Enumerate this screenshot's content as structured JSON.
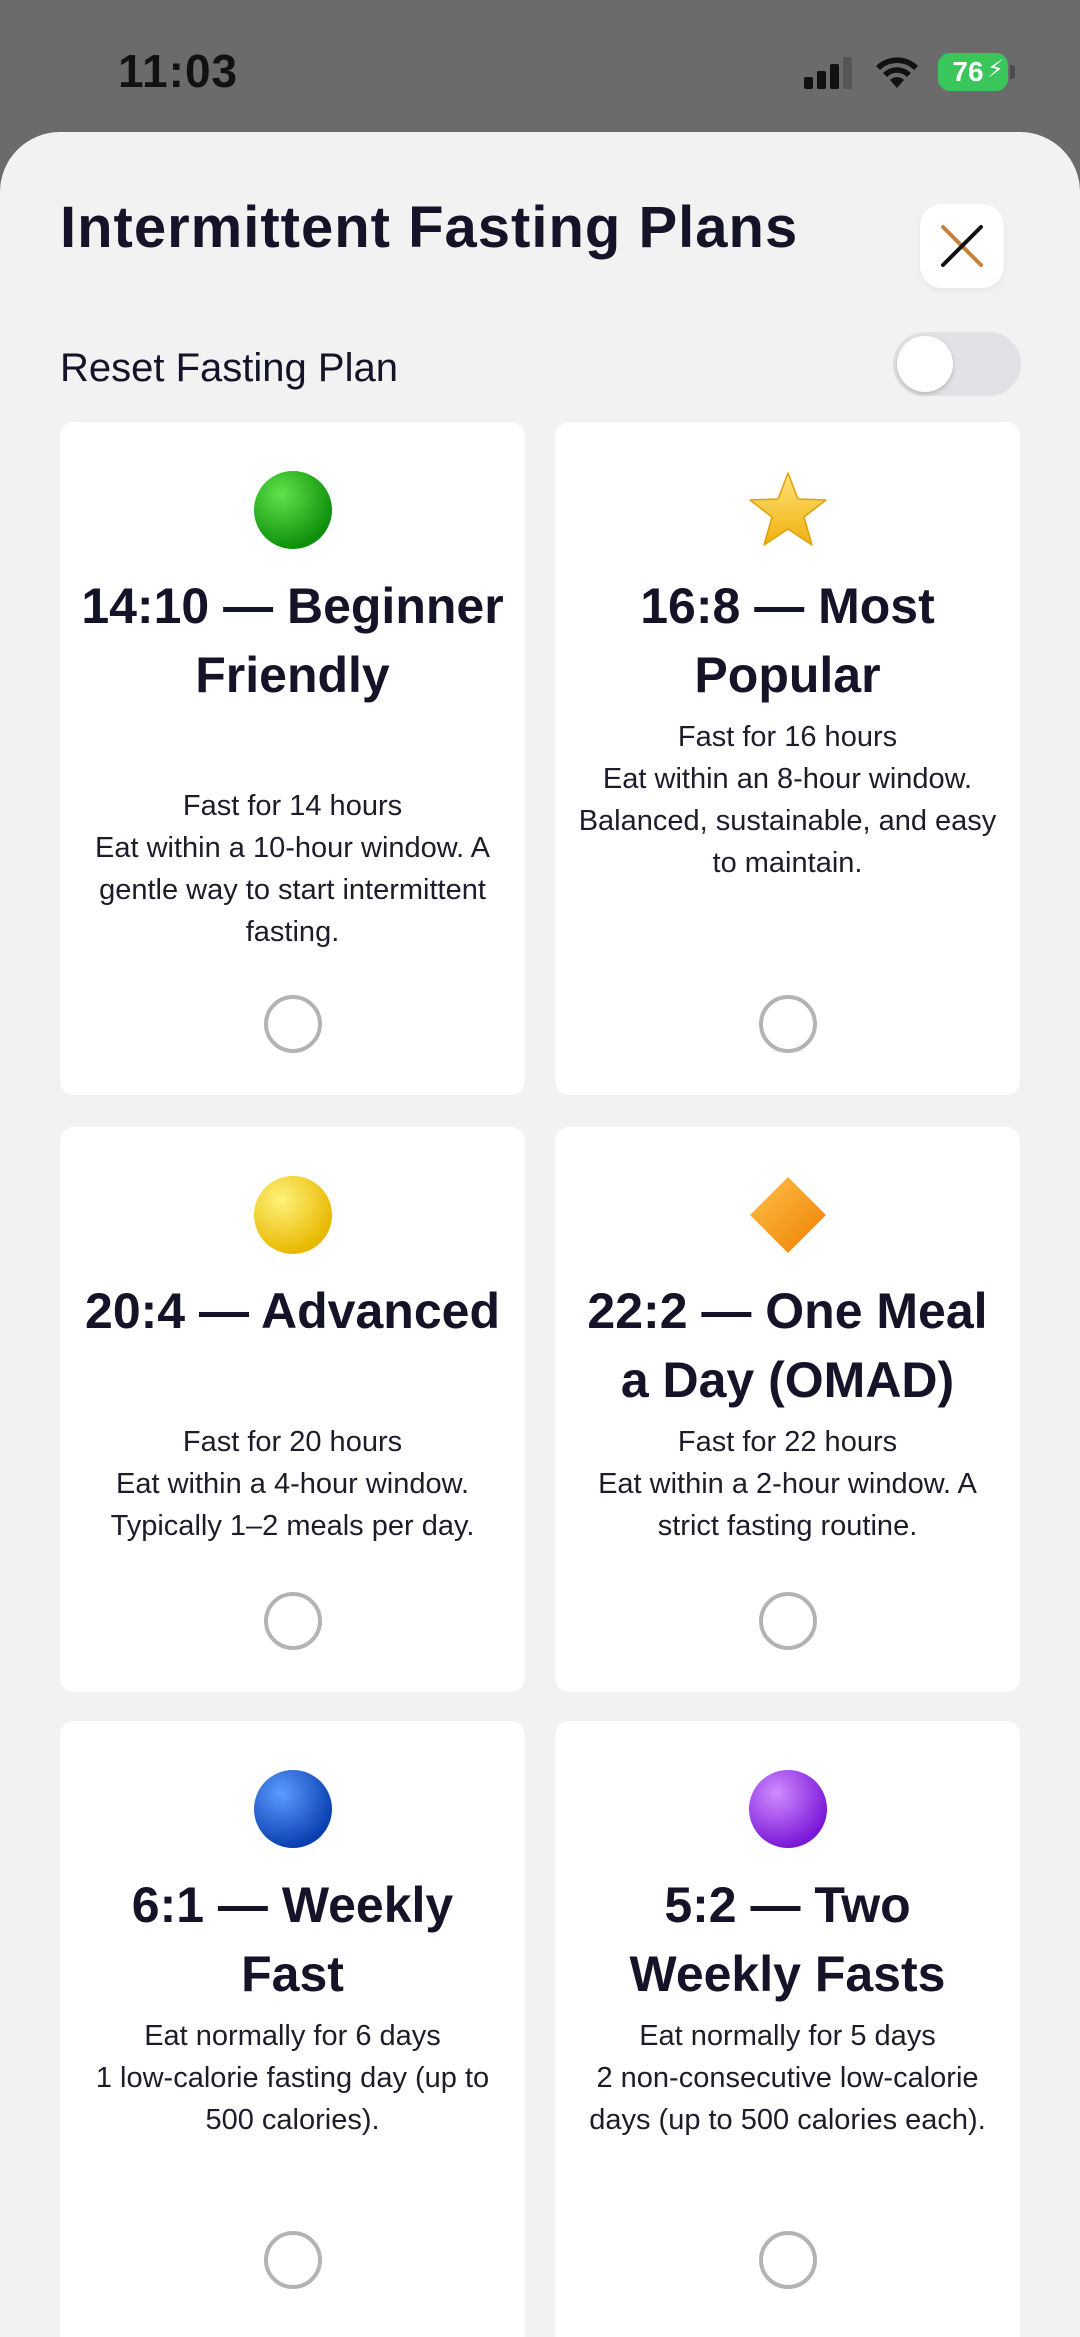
{
  "status_bar": {
    "time": "11:03",
    "battery": "76"
  },
  "sheet": {
    "title": "Intermittent Fasting Plans",
    "reset_label": "Reset Fasting Plan",
    "reset_enabled": false
  },
  "plans": [
    {
      "icon": "green-circle-icon",
      "color": "#1fb51a",
      "title": "14:10 — Beginner Friendly",
      "line1": "Fast for 14 hours",
      "line2": "Eat within a 10-hour window. A gentle way to start intermittent fasting.",
      "selected": false
    },
    {
      "icon": "star-icon",
      "color": "#f5c21b",
      "title": "16:8 — Most Popular",
      "line1": "Fast for 16 hours",
      "line2": "Eat within an 8-hour window. Balanced, sustainable, and easy to maintain.",
      "selected": false
    },
    {
      "icon": "yellow-circle-icon",
      "color": "#f5d400",
      "title": "20:4 — Advanced",
      "line1": "Fast for 20 hours",
      "line2": "Eat within a 4-hour window. Typically 1–2 meals per day.",
      "selected": false
    },
    {
      "icon": "orange-diamond-icon",
      "color": "#f59a0a",
      "title": "22:2 — One Meal a Day (OMAD)",
      "line1": "Fast for 22 hours",
      "line2": "Eat within a 2-hour window. A strict fasting routine.",
      "selected": false
    },
    {
      "icon": "blue-circle-icon",
      "color": "#1660d6",
      "title": "6:1 — Weekly Fast",
      "line1": "Eat normally for 6 days",
      "line2": "1 low-calorie fasting day (up to 500 calories).",
      "selected": false
    },
    {
      "icon": "purple-circle-icon",
      "color": "#9b3cf0",
      "title": "5:2 — Two Weekly Fasts",
      "line1": "Eat normally for 5 days",
      "line2": "2 non-consecutive low-calorie days (up to 500 calories each).",
      "selected": false
    }
  ]
}
